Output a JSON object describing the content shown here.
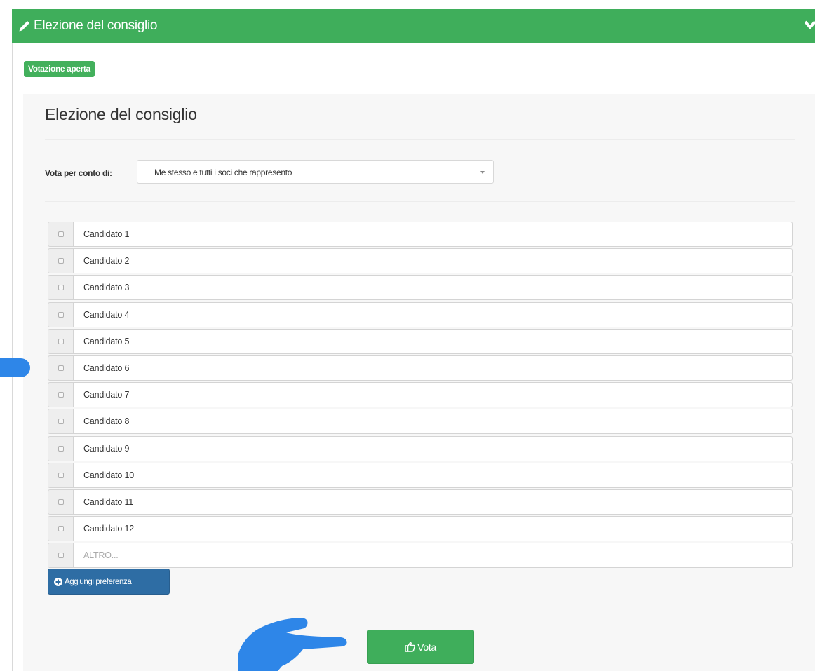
{
  "header": {
    "title": "Elezione del consiglio",
    "icon": "pencil-icon",
    "collapse_icon": "chevron-down-icon",
    "color": "#3fae5b"
  },
  "status_badge": "Votazione aperta",
  "panel": {
    "title": "Elezione del consiglio",
    "vote_on_behalf_label": "Vota per conto di:",
    "vote_on_behalf_value": "Me stesso e tutti i soci che rappresento"
  },
  "candidates": [
    {
      "label": "Candidato 1"
    },
    {
      "label": "Candidato 2"
    },
    {
      "label": "Candidato 3"
    },
    {
      "label": "Candidato 4"
    },
    {
      "label": "Candidato 5"
    },
    {
      "label": "Candidato 6"
    },
    {
      "label": "Candidato 7"
    },
    {
      "label": "Candidato 8"
    },
    {
      "label": "Candidato 9"
    },
    {
      "label": "Candidato 10"
    },
    {
      "label": "Candidato 11"
    },
    {
      "label": "Candidato 12"
    }
  ],
  "other": {
    "placeholder": "ALTRO..."
  },
  "buttons": {
    "add_preference": "Aggiungi preferenza",
    "vote": "Vota"
  },
  "colors": {
    "accent_green": "#3fae5b",
    "button_blue": "#2e6da4",
    "annotation_blue": "#2e86e8"
  }
}
